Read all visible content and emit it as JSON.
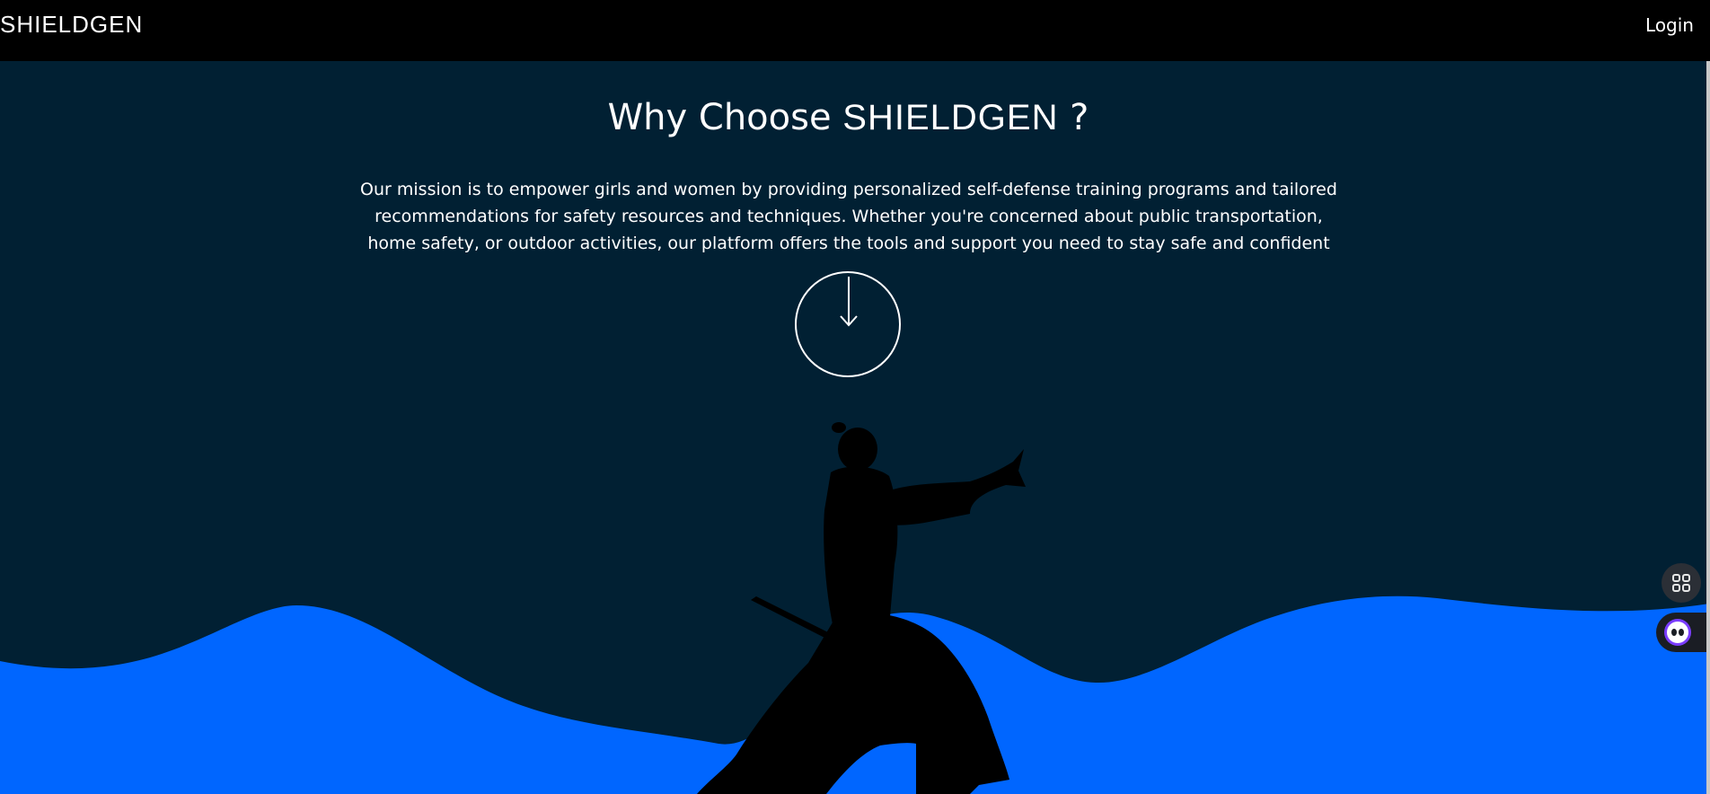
{
  "nav": {
    "brand": "SHIELDGEN",
    "login_label": "Login"
  },
  "hero": {
    "heading_prefix": "Why Choose",
    "heading_brand": "SHIELDGEN",
    "heading_suffix": "?",
    "mission": "Our mission is to empower girls and women by providing personalized self-defense training programs and tailored recommendations for safety resources and techniques. Whether you're concerned about public transportation, home safety, or outdoor activities, our platform offers the tools and support you need to stay safe and confident"
  },
  "icons": {
    "scroll": "arrow-down-icon",
    "grid": "grid-icon",
    "assistant": "assistant-icon",
    "illustration": "martial-artist-silhouette"
  },
  "colors": {
    "navbar": "#000000",
    "background": "#012033",
    "wave": "#0066ff",
    "silhouette": "#000000",
    "text": "#ffffff"
  }
}
